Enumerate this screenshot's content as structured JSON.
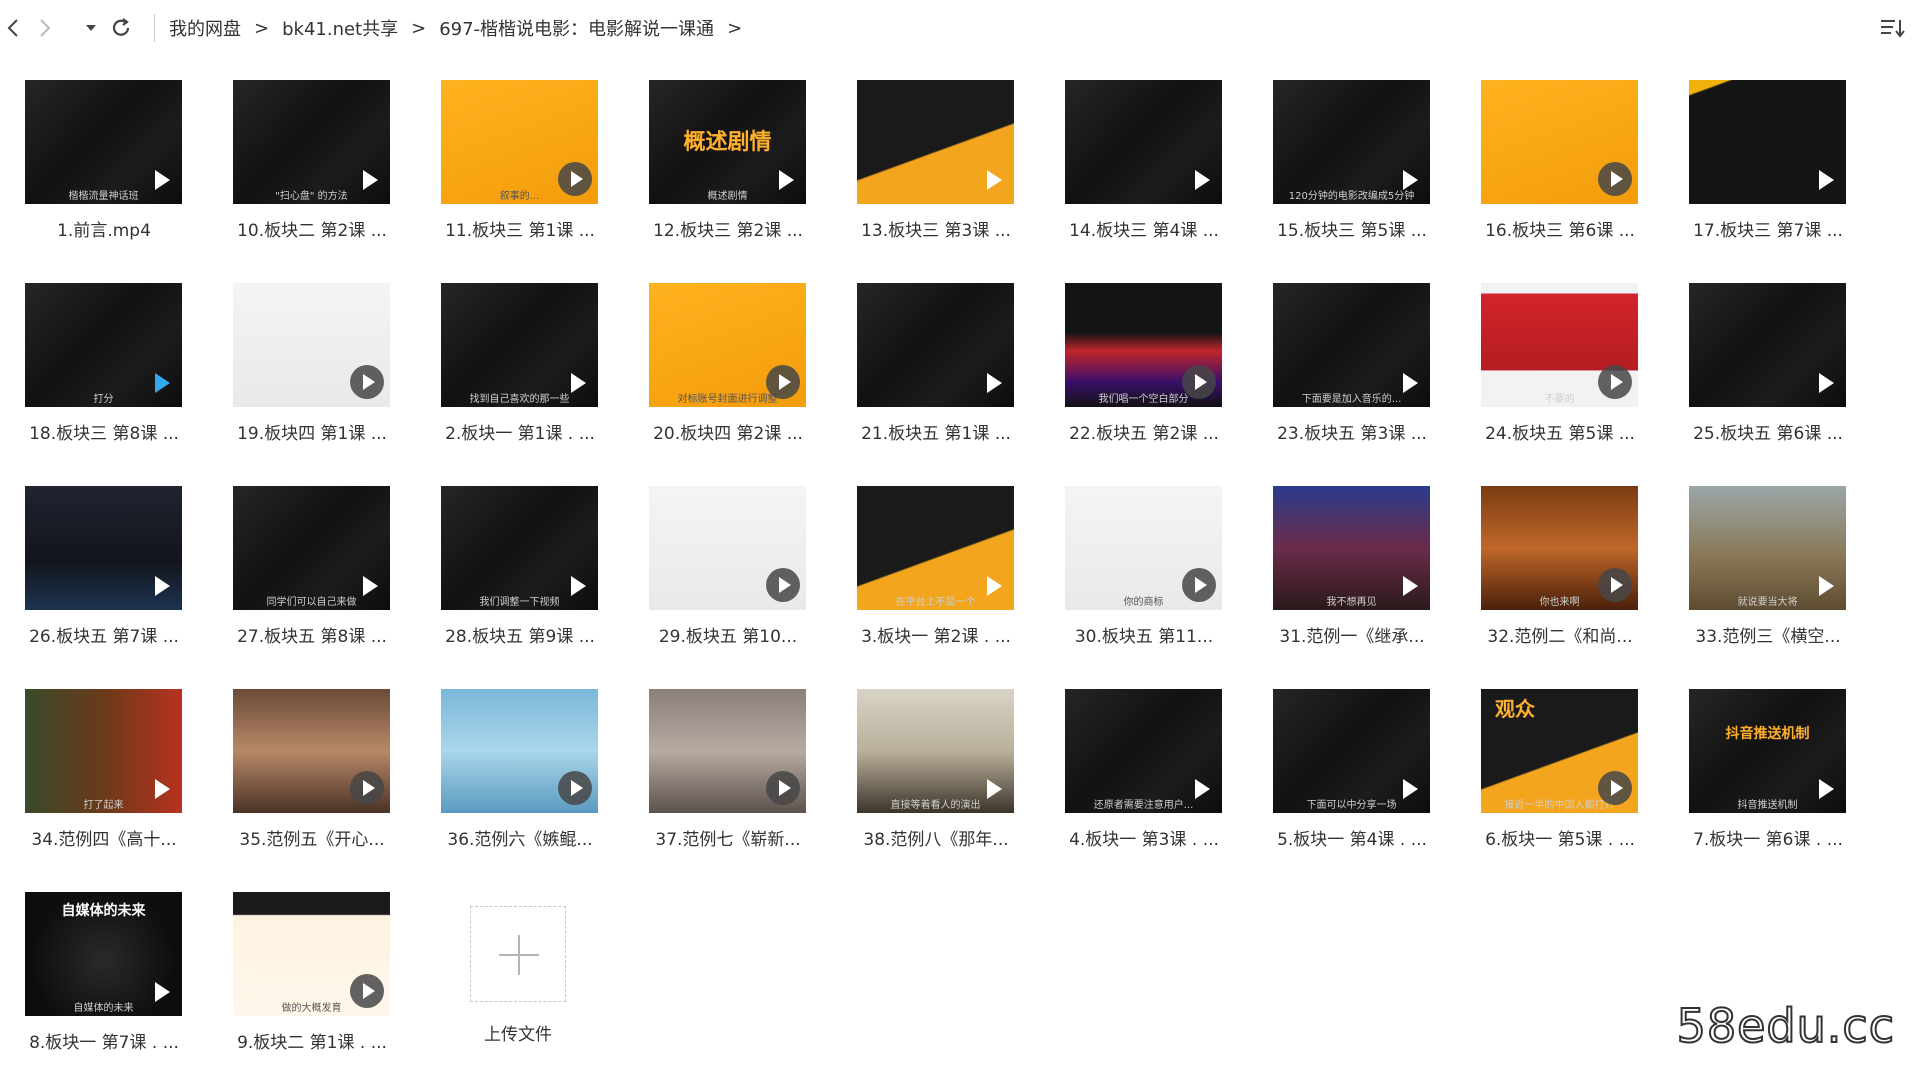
{
  "toolbar": {
    "back_icon": "chevron-left-icon",
    "forward_icon": "chevron-right-icon",
    "dropdown_icon": "caret-down-icon",
    "refresh_icon": "refresh-icon",
    "sort_icon": "sort-list-icon"
  },
  "breadcrumb": {
    "items": [
      "我的网盘",
      "bk41.net共享",
      "697-楷楷说电影：电影解说一课通"
    ],
    "separator": ">"
  },
  "files": [
    {
      "name": "1.前言.mp4",
      "caption": "楷楷流量神话班",
      "style": "dark"
    },
    {
      "name": "10.板块二 第2课 ...",
      "caption": "\"扫心盘\" 的方法",
      "style": "dark"
    },
    {
      "name": "11.板块三 第1课 ...",
      "caption": "叙事的...",
      "style": "orange"
    },
    {
      "name": "12.板块三 第2课 ...",
      "caption": "概述剧情",
      "headline": "概述剧情",
      "style": "dark"
    },
    {
      "name": "13.板块三 第3课 ...",
      "caption": "",
      "style": "dark-orange"
    },
    {
      "name": "14.板块三 第4课 ...",
      "caption": "",
      "style": "dark"
    },
    {
      "name": "15.板块三 第5课 ...",
      "caption": "120分钟的电影改编成5分钟",
      "style": "dark"
    },
    {
      "name": "16.板块三 第6课 ...",
      "caption": "",
      "style": "orange"
    },
    {
      "name": "17.板块三 第7课 ...",
      "caption": "",
      "style": "dark-yellow"
    },
    {
      "name": "18.板块三 第8课 ...",
      "caption": "打分",
      "style": "dark"
    },
    {
      "name": "19.板块四 第1课 ...",
      "caption": "",
      "style": "light"
    },
    {
      "name": "2.板块一 第1课 . ...",
      "caption": "找到自己喜欢的那一些",
      "style": "dark"
    },
    {
      "name": "20.板块四 第2课 ...",
      "caption": "对标账号封面进行调整",
      "style": "orange"
    },
    {
      "name": "21.板块五 第1课 ...",
      "caption": "",
      "style": "dark"
    },
    {
      "name": "22.板块五 第2课 ...",
      "caption": "我们唱一个空白部分",
      "style": "dark-red"
    },
    {
      "name": "23.板块五 第3课 ...",
      "caption": "下面要是加入音乐的...",
      "style": "dark"
    },
    {
      "name": "24.板块五 第5课 ...",
      "caption": "不要的",
      "style": "red"
    },
    {
      "name": "25.板块五 第6课 ...",
      "caption": "",
      "style": "dark"
    },
    {
      "name": "26.板块五 第7课 ...",
      "caption": "",
      "style": "dark-blue"
    },
    {
      "name": "27.板块五 第8课 ...",
      "caption": "同学们可以自己来做",
      "style": "dark"
    },
    {
      "name": "28.板块五 第9课 ...",
      "caption": "我们调整一下视频",
      "style": "dark"
    },
    {
      "name": "29.板块五 第10...",
      "caption": "",
      "style": "light"
    },
    {
      "name": "3.板块一 第2课 . ...",
      "caption": "在平台上不是一个",
      "style": "dark-orange"
    },
    {
      "name": "30.板块五 第11...",
      "caption": "你的商标",
      "style": "light"
    },
    {
      "name": "31.范例一《继承...",
      "caption": "我不想再见",
      "style": "photo-crowd"
    },
    {
      "name": "32.范例二《和尚...",
      "caption": "你也来啊",
      "style": "photo-warm"
    },
    {
      "name": "33.范例三《横空...",
      "caption": "就说要当大将",
      "style": "photo-field"
    },
    {
      "name": "34.范例四《高十...",
      "caption": "打了起来",
      "style": "photo-red"
    },
    {
      "name": "35.范例五《开心...",
      "caption": "",
      "style": "photo-faces"
    },
    {
      "name": "36.范例六《嫉鲲...",
      "caption": "",
      "style": "photo-blue"
    },
    {
      "name": "37.范例七《崭新...",
      "caption": "",
      "style": "photo-grey"
    },
    {
      "name": "38.范例八《那年...",
      "caption": "直接等着看人的演出",
      "style": "photo-man"
    },
    {
      "name": "4.板块一 第3课 . ...",
      "caption": "还原者需要注意用户...",
      "style": "dark"
    },
    {
      "name": "5.板块一 第4课 . ...",
      "caption": "下面可以中分享一场",
      "style": "dark"
    },
    {
      "name": "6.板块一 第5课 . ...",
      "caption": "接近一半的中国人都打开",
      "headline": "观众",
      "style": "dark-orange"
    },
    {
      "name": "7.板块一 第6课 . ...",
      "caption": "抖音推送机制",
      "headline": "抖音推送机制",
      "style": "dark"
    },
    {
      "name": "8.板块一 第7课 . ...",
      "caption": "自媒体的未来",
      "headline": "自媒体的未来",
      "style": "dark-tiktok"
    },
    {
      "name": "9.板块二 第1课 . ...",
      "caption": "做的大概发育",
      "style": "light-orange"
    }
  ],
  "upload": {
    "label": "上传文件",
    "icon": "plus-icon"
  },
  "watermark": "58edu.cc"
}
